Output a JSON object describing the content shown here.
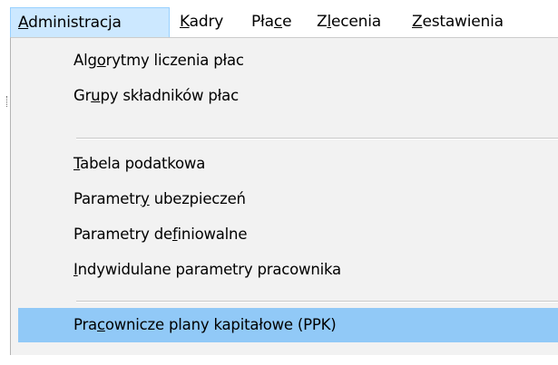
{
  "menubar": {
    "items": [
      {
        "prefix": "",
        "mnemonic": "A",
        "suffix": "dministracja"
      },
      {
        "prefix": "",
        "mnemonic": "K",
        "suffix": "adry"
      },
      {
        "prefix": "Pła",
        "mnemonic": "c",
        "suffix": "e"
      },
      {
        "prefix": "Z",
        "mnemonic": "l",
        "suffix": "ecenia"
      },
      {
        "prefix": "",
        "mnemonic": "Z",
        "suffix": "estawienia"
      }
    ]
  },
  "dropdown": {
    "items": [
      {
        "prefix": "Alg",
        "mnemonic": "o",
        "suffix": "rytmy liczenia płac"
      },
      {
        "prefix": "Gr",
        "mnemonic": "u",
        "suffix": "py składników płac"
      },
      {
        "prefix": "",
        "mnemonic": "T",
        "suffix": "abela podatkowa"
      },
      {
        "prefix": "Parametr",
        "mnemonic": "y",
        "suffix": " ubezpieczeń"
      },
      {
        "prefix": "Parametry de",
        "mnemonic": "f",
        "suffix": "iniowalne"
      },
      {
        "prefix": "",
        "mnemonic": "I",
        "suffix": "ndywidulane parametry pracownika"
      },
      {
        "prefix": "Pra",
        "mnemonic": "c",
        "suffix": "ownicze plany kapitałowe (PPK)"
      }
    ]
  },
  "colors": {
    "menubar_active_bg": "#cce8ff",
    "menubar_active_border": "#99d1ff",
    "dropdown_bg": "#f2f2f2",
    "item_highlight_bg": "#91c9f7"
  }
}
